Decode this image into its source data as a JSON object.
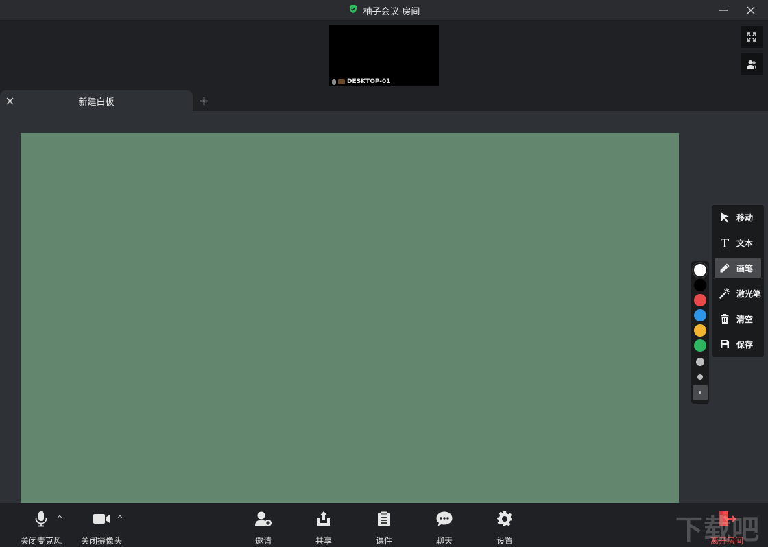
{
  "window": {
    "title": "柚子会议-房间",
    "accent": "#2dbd5c"
  },
  "video": {
    "participant_name": "DESKTOP-01"
  },
  "tabs": [
    {
      "label": "新建白板",
      "active": true
    }
  ],
  "whiteboard": {
    "background": "#62876e"
  },
  "palette": {
    "colors": [
      "#ffffff",
      "#000000",
      "#e84a4a",
      "#2f95e6",
      "#f2b431",
      "#2db761"
    ],
    "selected_color": "#ffffff",
    "pen_sizes": [
      "large",
      "medium",
      "small"
    ],
    "selected_size": "small"
  },
  "tools": [
    {
      "label": "移动",
      "icon": "cursor-arrow-icon"
    },
    {
      "label": "文本",
      "icon": "text-icon"
    },
    {
      "label": "画笔",
      "icon": "pencil-icon",
      "active": true
    },
    {
      "label": "激光笔",
      "icon": "laser-wand-icon"
    },
    {
      "label": "清空",
      "icon": "trash-icon"
    },
    {
      "label": "保存",
      "icon": "save-icon"
    }
  ],
  "bottom_toolbar": {
    "mic": "关闭麦克风",
    "camera": "关闭摄像头",
    "invite": "邀请",
    "share": "共享",
    "courseware": "课件",
    "chat": "聊天",
    "settings": "设置",
    "leave": "离开房间",
    "leave_color": "#e84a4a"
  },
  "watermark": "下载吧"
}
